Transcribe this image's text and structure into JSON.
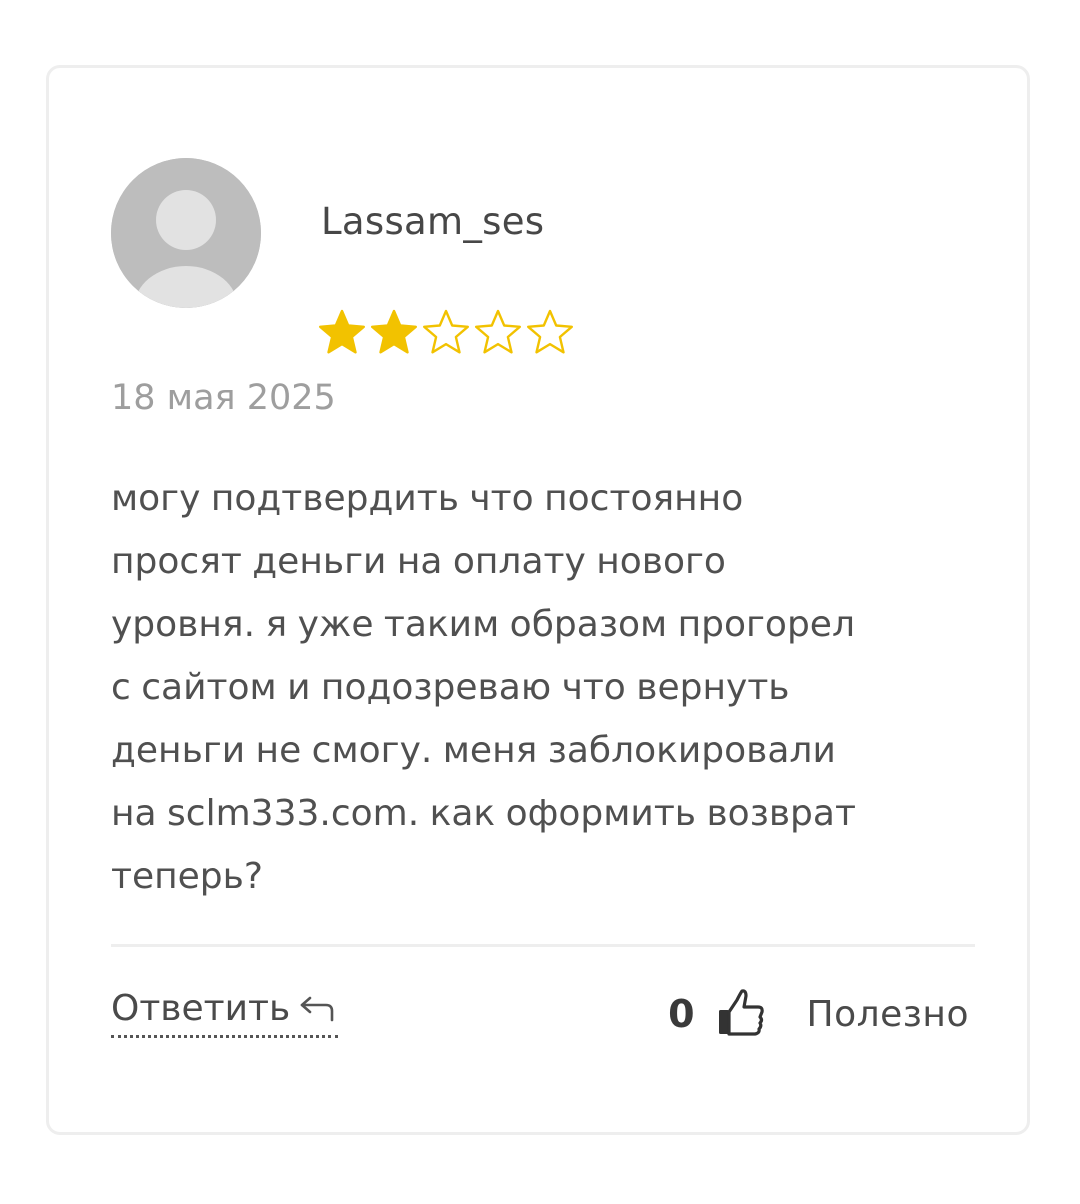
{
  "review": {
    "author": "Lassam_ses",
    "rating": 2,
    "max_rating": 5,
    "star_color": "#f2c200",
    "date": "18 мая 2025",
    "lines": [
      "могу подтвердить что постоянно",
      "просят деньги на оплату нового",
      "уровня. я уже таким образом прогорел",
      "с сайтом и подозреваю что вернуть",
      "деньги не смогу. меня заблокировали",
      "на sclm333.com. как оформить возврат",
      "теперь?"
    ]
  },
  "actions": {
    "reply_label": "Ответить",
    "reply_icon": "reply-arrow-icon",
    "helpful_count": "0",
    "like_icon": "thumbs-up-icon",
    "helpful_label": "Полезно"
  }
}
